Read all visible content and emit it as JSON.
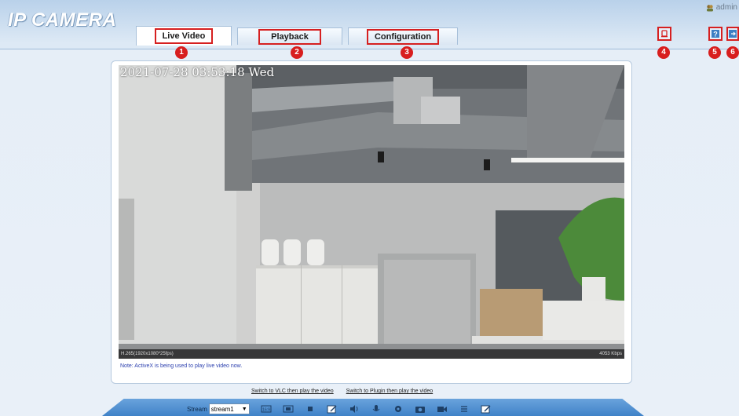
{
  "header": {
    "logo": "IP CAMERA",
    "user": "admin"
  },
  "tabs": [
    {
      "label": "Live Video",
      "active": true,
      "marker": "1"
    },
    {
      "label": "Playback",
      "active": false,
      "marker": "2"
    },
    {
      "label": "Configuration",
      "active": false,
      "marker": "3"
    }
  ],
  "header_icons": [
    {
      "name": "alarm-icon",
      "marker": "4"
    },
    {
      "name": "help-icon",
      "marker": "5"
    },
    {
      "name": "logout-icon",
      "marker": "6"
    }
  ],
  "video": {
    "osd_time": "2021-07-28 03:53:18 Wed",
    "codec_info": "H.265(1920x1080*25fps)",
    "bitrate": "4053 Kbps"
  },
  "note": "Note: ActiveX is being used to play live video now.",
  "links": {
    "vlc": "Switch to VLC then play the video",
    "plugin": "Switch to Plugin then play the video"
  },
  "toolbar": {
    "stream_label": "Stream",
    "stream_value": "stream1",
    "buttons": [
      "aspect-ratio-icon",
      "fullscreen-icon",
      "stop-icon",
      "record-edit-icon",
      "volume-icon",
      "microphone-icon",
      "settings-icon",
      "snapshot-icon",
      "video-record-icon",
      "list-icon",
      "edit-icon"
    ]
  },
  "colors": {
    "marker_red": "#d81e1e",
    "toolbar_blue": "#4a8bcf",
    "note_blue": "#2b3fae"
  }
}
